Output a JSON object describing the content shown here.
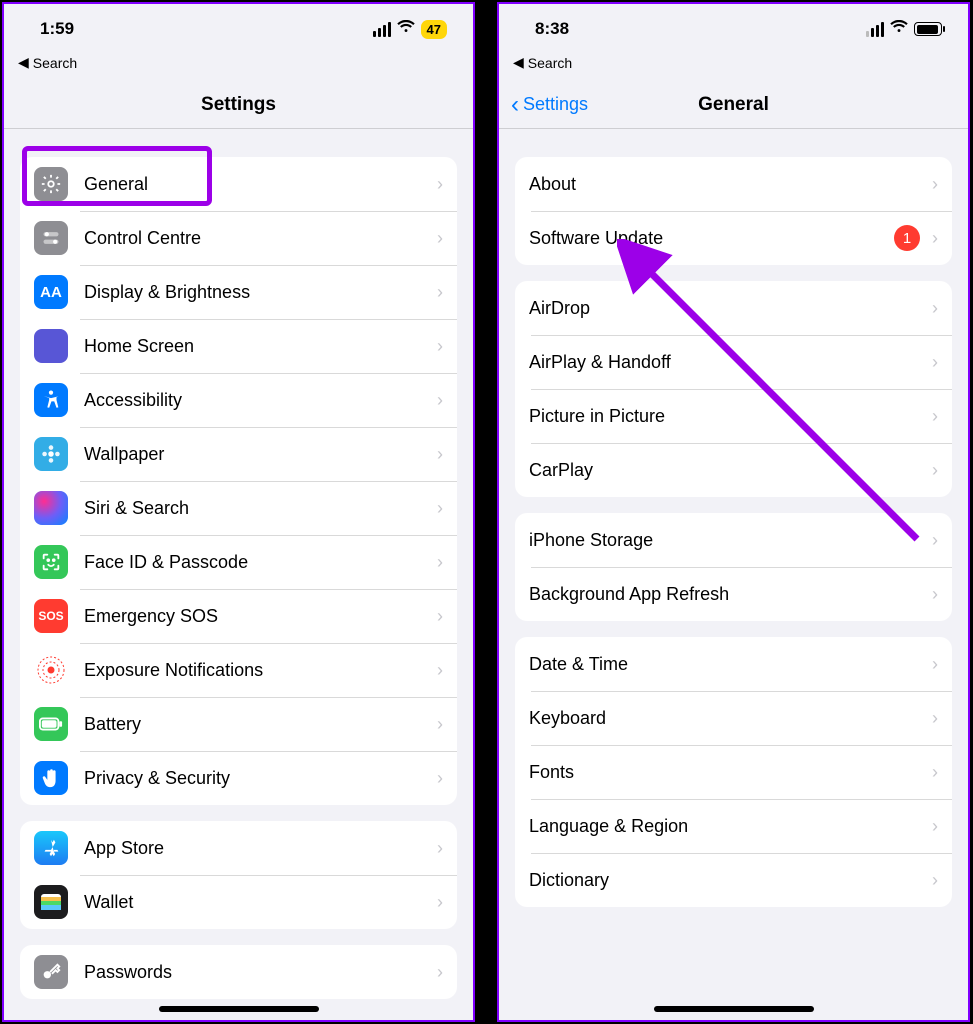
{
  "left": {
    "time": "1:59",
    "back_search": "Search",
    "battery_label": "47",
    "title": "Settings",
    "group1": [
      {
        "label": "General",
        "icon": "gear",
        "name": "general"
      },
      {
        "label": "Control Centre",
        "icon": "switches",
        "name": "control-centre"
      },
      {
        "label": "Display & Brightness",
        "icon": "aa",
        "name": "display-brightness"
      },
      {
        "label": "Home Screen",
        "icon": "grid",
        "name": "home-screen"
      },
      {
        "label": "Accessibility",
        "icon": "person",
        "name": "accessibility"
      },
      {
        "label": "Wallpaper",
        "icon": "flower",
        "name": "wallpaper"
      },
      {
        "label": "Siri & Search",
        "icon": "siri",
        "name": "siri-search"
      },
      {
        "label": "Face ID & Passcode",
        "icon": "face",
        "name": "faceid-passcode"
      },
      {
        "label": "Emergency SOS",
        "icon": "sos",
        "name": "emergency-sos"
      },
      {
        "label": "Exposure Notifications",
        "icon": "expo",
        "name": "exposure-notifications"
      },
      {
        "label": "Battery",
        "icon": "battery",
        "name": "battery"
      },
      {
        "label": "Privacy & Security",
        "icon": "hand",
        "name": "privacy-security"
      }
    ],
    "group2": [
      {
        "label": "App Store",
        "icon": "appstore",
        "name": "app-store"
      },
      {
        "label": "Wallet",
        "icon": "wallet",
        "name": "wallet"
      }
    ],
    "group3": [
      {
        "label": "Passwords",
        "icon": "key",
        "name": "passwords"
      }
    ]
  },
  "right": {
    "time": "8:38",
    "back_search": "Search",
    "back_label": "Settings",
    "title": "General",
    "badge": "1",
    "group1": [
      {
        "label": "About",
        "name": "about"
      },
      {
        "label": "Software Update",
        "name": "software-update",
        "badge": true
      }
    ],
    "group2": [
      {
        "label": "AirDrop",
        "name": "airdrop"
      },
      {
        "label": "AirPlay & Handoff",
        "name": "airplay-handoff"
      },
      {
        "label": "Picture in Picture",
        "name": "picture-in-picture"
      },
      {
        "label": "CarPlay",
        "name": "carplay"
      }
    ],
    "group3": [
      {
        "label": "iPhone Storage",
        "name": "iphone-storage"
      },
      {
        "label": "Background App Refresh",
        "name": "background-app-refresh"
      }
    ],
    "group4": [
      {
        "label": "Date & Time",
        "name": "date-time"
      },
      {
        "label": "Keyboard",
        "name": "keyboard"
      },
      {
        "label": "Fonts",
        "name": "fonts"
      },
      {
        "label": "Language & Region",
        "name": "language-region"
      },
      {
        "label": "Dictionary",
        "name": "dictionary"
      }
    ]
  }
}
